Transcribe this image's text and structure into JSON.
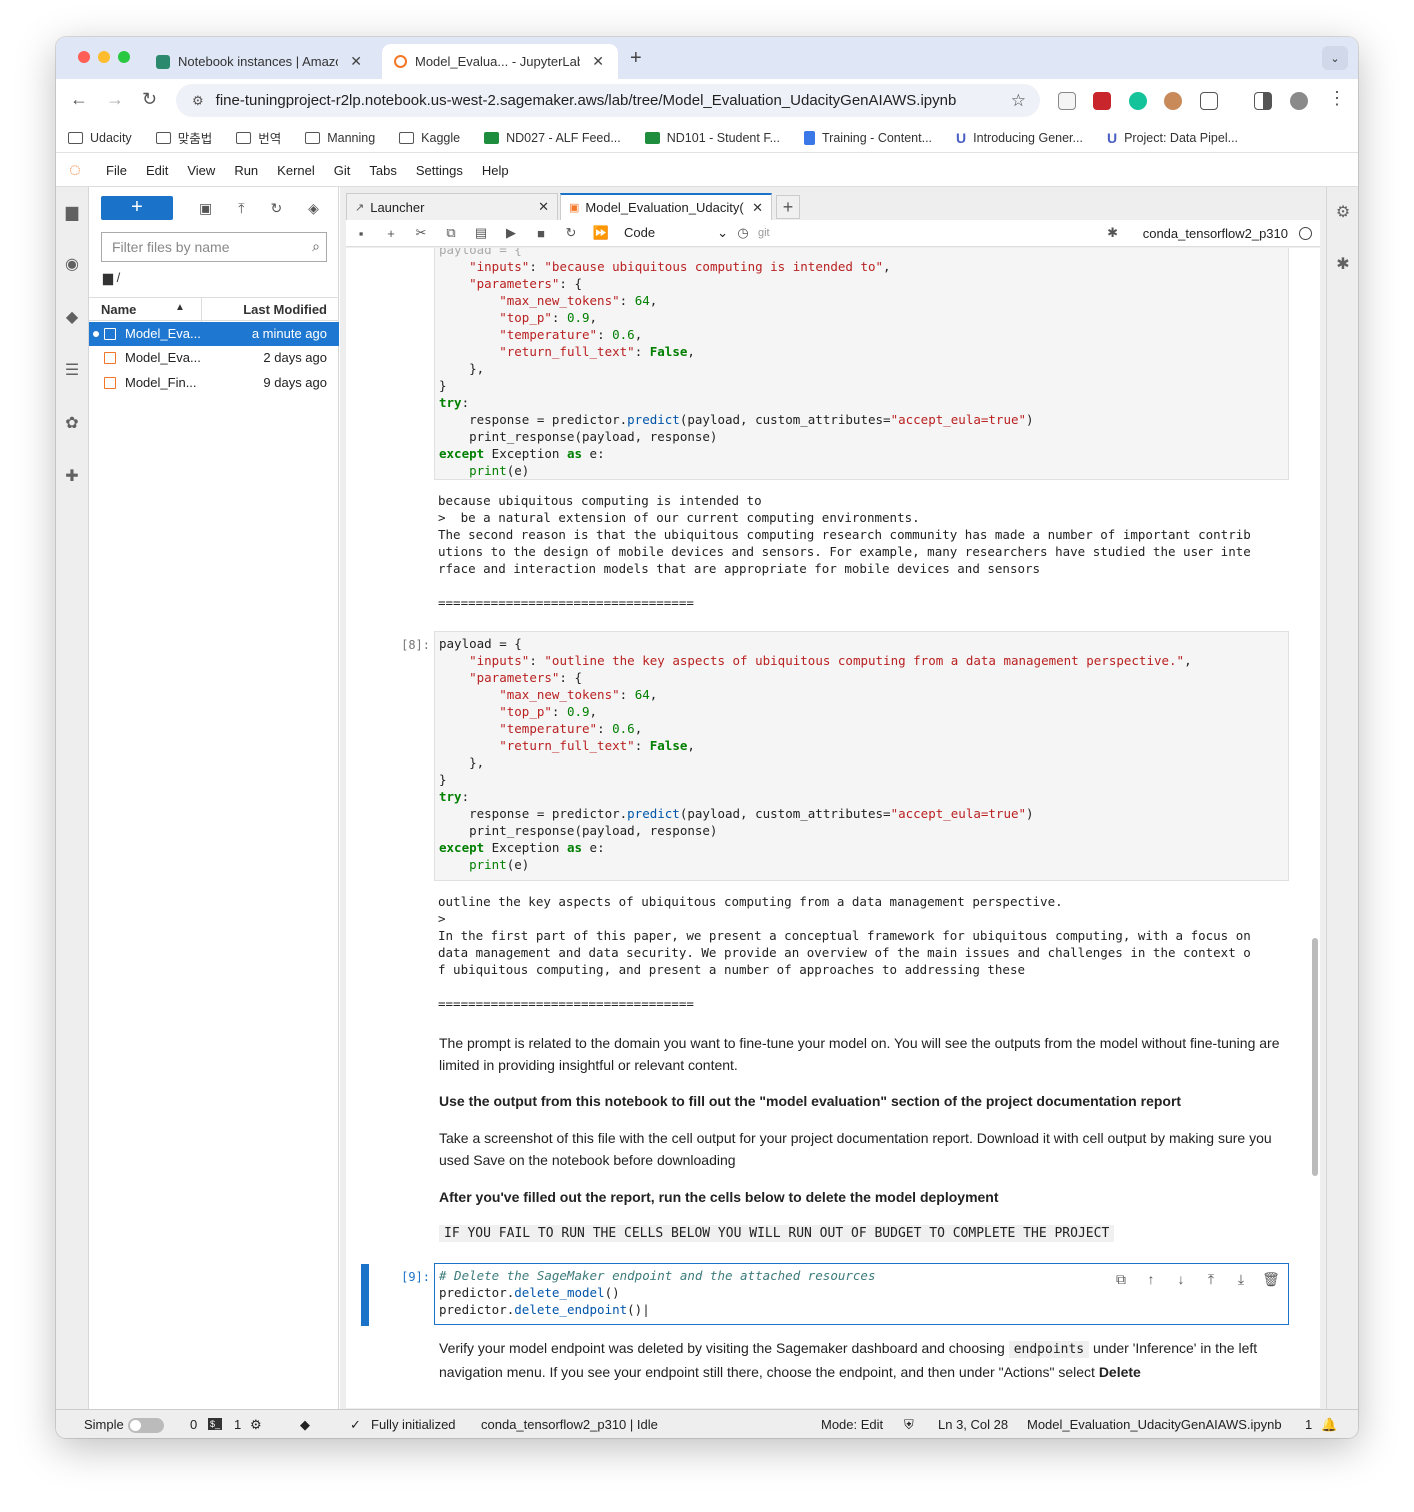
{
  "browser": {
    "tabs": [
      {
        "title": "Notebook instances | Amazon",
        "color": "#2b8a6e"
      },
      {
        "title": "Model_Evalua... - JupyterLab",
        "color": "#f37726"
      }
    ],
    "url": "fine-tuningproject-r2lp.notebook.us-west-2.sagemaker.aws/lab/tree/Model_Evaluation_UdacityGenAIAWS.ipynb",
    "bookmarks": [
      {
        "label": "Udacity",
        "icon": "folder-icon"
      },
      {
        "label": "맞춤법",
        "icon": "folder-icon"
      },
      {
        "label": "번역",
        "icon": "folder-icon"
      },
      {
        "label": "Manning",
        "icon": "folder-icon"
      },
      {
        "label": "Kaggle",
        "icon": "folder-icon"
      },
      {
        "label": "ND027 - ALF Feed...",
        "icon": "sheet-icon"
      },
      {
        "label": "ND101 - Student F...",
        "icon": "sheet-icon"
      },
      {
        "label": "Training - Content...",
        "icon": "doc-icon"
      },
      {
        "label": "Introducing Gener...",
        "icon": "udacity-icon"
      },
      {
        "label": "Project: Data Pipel...",
        "icon": "udacity-icon"
      }
    ]
  },
  "menu": [
    "File",
    "Edit",
    "View",
    "Run",
    "Kernel",
    "Git",
    "Tabs",
    "Settings",
    "Help"
  ],
  "filebrowser": {
    "filter_placeholder": "Filter files by name",
    "breadcrumb": "/",
    "col_name": "Name",
    "col_modified": "Last Modified",
    "files": [
      {
        "name": "Model_Eva...",
        "modified": "a minute ago"
      },
      {
        "name": "Model_Eva...",
        "modified": "2 days ago"
      },
      {
        "name": "Model_Fin...",
        "modified": "9 days ago"
      }
    ]
  },
  "doc_tabs": {
    "launcher": "Launcher",
    "notebook": "Model_Evaluation_Udacity("
  },
  "nb_toolbar": {
    "cell_type": "Code",
    "git": "git",
    "kernel": "conda_tensorflow2_p310"
  },
  "cells": {
    "prompt8": "[8]:",
    "prompt9": "[9]:",
    "output7_lines": [
      "because ubiquitous computing is intended to",
      ">  be a natural extension of our current computing environments.",
      "The second reason is that the ubiquitous computing research community has made a number of important contrib",
      "utions to the design of mobile devices and sensors. For example, many researchers have studied the user inte",
      "rface and interaction models that are appropriate for mobile devices and sensors",
      "",
      "=================================="
    ],
    "output8_lines": [
      "outline the key aspects of ubiquitous computing from a data management perspective.",
      ">",
      "In the first part of this paper, we present a conceptual framework for ubiquitous computing, with a focus on",
      "data management and data security. We provide an overview of the main issues and challenges in the context o",
      "f ubiquitous computing, and present a number of approaches to addressing these",
      "",
      "=================================="
    ]
  },
  "markdown": {
    "p1": "The prompt is related to the domain you want to fine-tune your model on. You will see the outputs from the model without fine-tuning are limited in providing insightful or relevant content.",
    "p2": "Use the output from this notebook to fill out the \"model evaluation\" section of the project documentation report",
    "p3": "Take a screenshot of this file with the cell output for your project documentation report. Download it with cell output by making sure you used Save on the notebook before downloading",
    "p4": "After you've filled out the report, run the cells below to delete the model deployment",
    "p5": "IF YOU FAIL TO RUN THE CELLS BELOW YOU WILL RUN OUT OF BUDGET TO COMPLETE THE PROJECT",
    "p6a": "Verify your model endpoint was deleted by visiting the Sagemaker dashboard and choosing",
    "p6code": "endpoints",
    "p6b": "under 'Inference' in the left navigation menu. If you see your endpoint still there, choose the endpoint, and then under \"Actions\" select",
    "p6bold": "Delete"
  },
  "statusbar": {
    "mode_label": "Simple",
    "terminals": "0",
    "kernels": "1",
    "status": "Fully initialized",
    "kernel_status": "conda_tensorflow2_p310 | Idle",
    "mode": "Mode: Edit",
    "position": "Ln 3, Col 28",
    "filename": "Model_Evaluation_UdacityGenAIAWS.ipynb",
    "notifications": "1"
  }
}
